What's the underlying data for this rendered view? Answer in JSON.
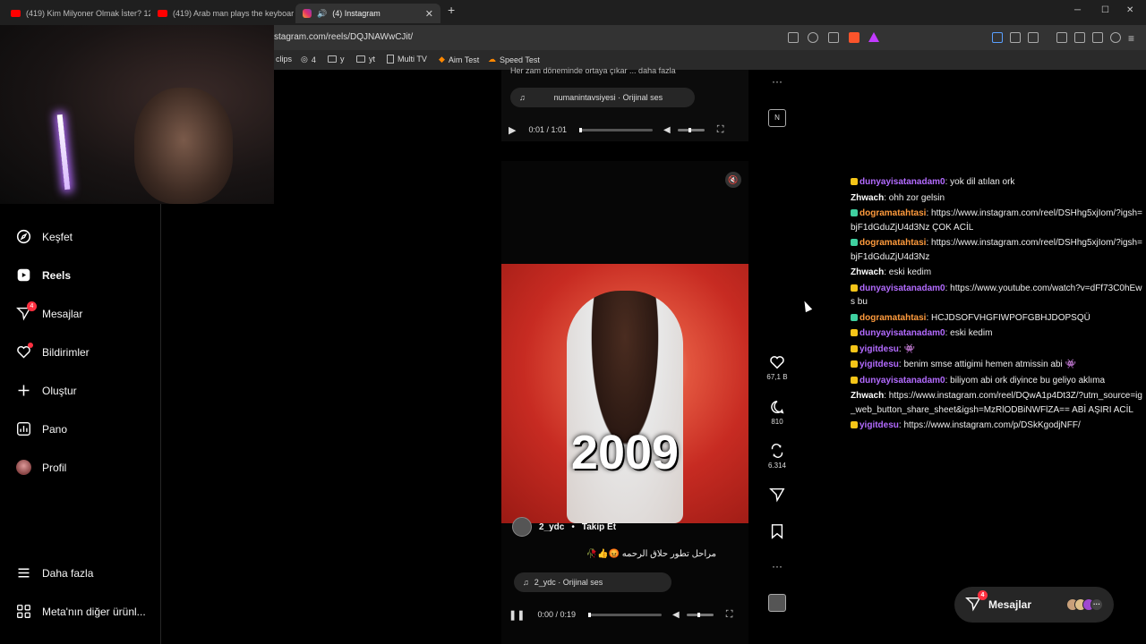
{
  "browser": {
    "tabs": [
      {
        "title": "(419) Kim Milyoner Olmak İster? 120..."
      },
      {
        "title": "(419) Arab man plays the keyboard w..."
      },
      {
        "title": "(4) Instagram"
      }
    ],
    "url": "stagram.com/reels/DQJNAWwCJit/",
    "bookmarks": [
      "clips",
      "4",
      "y",
      "yt",
      "Multi TV",
      "Aim Test",
      "Speed Test"
    ]
  },
  "sidebar": {
    "items": [
      {
        "label": "Keşfet",
        "icon": "compass-icon"
      },
      {
        "label": "Reels",
        "icon": "reels-icon"
      },
      {
        "label": "Mesajlar",
        "icon": "messenger-icon",
        "badge": "4"
      },
      {
        "label": "Bildirimler",
        "icon": "heart-icon"
      },
      {
        "label": "Oluştur",
        "icon": "plus-icon"
      },
      {
        "label": "Pano",
        "icon": "dashboard-icon"
      },
      {
        "label": "Profil",
        "icon": "avatar-icon"
      },
      {
        "label": "Daha fazla",
        "icon": "menu-icon"
      },
      {
        "label": "Meta'nın diğer ürünl...",
        "icon": "apps-icon"
      }
    ]
  },
  "reel1": {
    "caption": "Her zam döneminde ortaya çıkar ... daha fazla",
    "audio": "numanintavsiyesi · Orijinal ses",
    "time": "0:01 / 1:01"
  },
  "reel2": {
    "overlay_text": "2009",
    "username": "2_ydc",
    "follow": "Takip Et",
    "description": "مراحل تطور حلاق الرحمه",
    "audio": "2_ydc · Orijinal ses",
    "time": "0:00 / 0:19",
    "likes": "67,1 B",
    "comments": "810",
    "shares": "6.314"
  },
  "chat": [
    {
      "user": "dunyayisatanadam0",
      "color": "#b36bff",
      "text": "yok dil atılan ork"
    },
    {
      "user": "Zhwach",
      "color": "#ffffff",
      "text": "ohh zor gelsin"
    },
    {
      "user": "dogramatahtasi",
      "color": "#ff9b3d",
      "text": "https://www.instagram.com/reel/DSHhg5xjIom/?igsh=bjF1dGduZjU4d3Nz ÇOK ACİL"
    },
    {
      "user": "dogramatahtasi",
      "color": "#ff9b3d",
      "text": "https://www.instagram.com/reel/DSHhg5xjIom/?igsh=bjF1dGduZjU4d3Nz"
    },
    {
      "user": "Zhwach",
      "color": "#ffffff",
      "text": "eski kedim"
    },
    {
      "user": "dunyayisatanadam0",
      "color": "#b36bff",
      "text": "https://www.youtube.com/watch?v=dFf73C0hEws bu"
    },
    {
      "user": "dogramatahtasi",
      "color": "#ff9b3d",
      "text": "HCJDSOFVHGFIWPOFGBHJDOPSQÜ"
    },
    {
      "user": "dunyayisatanadam0",
      "color": "#b36bff",
      "text": "eski kedim"
    },
    {
      "user": "yigitdesu",
      "color": "#b36bff",
      "text": "👾"
    },
    {
      "user": "yigitdesu",
      "color": "#b36bff",
      "text": "benim smse attigimi hemen atmissin abi 👾"
    },
    {
      "user": "dunyayisatanadam0",
      "color": "#b36bff",
      "text": "biliyom abi ork diyince bu geliyo aklıma"
    },
    {
      "user": "Zhwach",
      "color": "#ffffff",
      "text": "https://www.instagram.com/reel/DQwA1p4Dt3Z/?utm_source=ig_web_button_share_sheet&igsh=MzRlODBiNWFlZA== ABİ AŞIRI ACİL"
    },
    {
      "user": "yigitdesu",
      "color": "#b36bff",
      "text": "https://www.instagram.com/p/DSkKgodjNFF/"
    }
  ],
  "messages_pill": {
    "label": "Mesajlar",
    "badge": "4"
  }
}
